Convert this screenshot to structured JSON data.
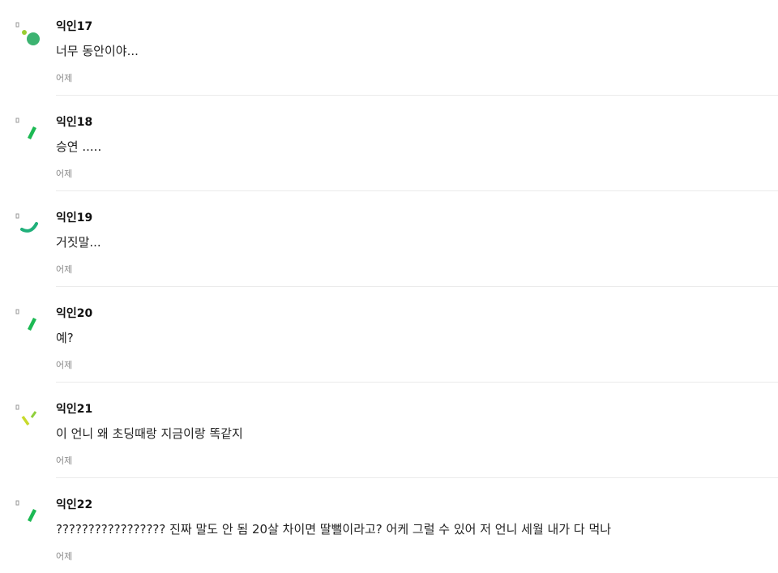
{
  "comments": [
    {
      "nickname": "익인17",
      "text": "너무 동안이야...",
      "time": "어제",
      "avatar_icon": "green-dots-avatar-icon",
      "avatar_color": "#3cb371",
      "avatar_accent": "#9acd32"
    },
    {
      "nickname": "익인18",
      "text": "승연 .....",
      "time": "어제",
      "avatar_icon": "green-slash-avatar-icon",
      "avatar_color": "#1db954"
    },
    {
      "nickname": "익인19",
      "text": "거짓말...",
      "time": "어제",
      "avatar_icon": "green-curve-avatar-icon",
      "avatar_color": "#20b07a"
    },
    {
      "nickname": "익인20",
      "text": "예?",
      "time": "어제",
      "avatar_icon": "green-slash-avatar-icon",
      "avatar_color": "#1db954"
    },
    {
      "nickname": "익인21",
      "text": "이 언니 왜 초딩때랑 지금이랑 똑같지",
      "time": "어제",
      "avatar_icon": "lime-strokes-avatar-icon",
      "avatar_color": "#b8d630",
      "avatar_accent": "#1db954"
    },
    {
      "nickname": "익인22",
      "text": "????????????????? 진짜 말도 안 됨 20살 차이면 딸뻘이라고? 어케 그럴 수 있어 저 언니 세월 내가 다 먹나",
      "time": "어제",
      "avatar_icon": "green-slash-avatar-icon",
      "avatar_color": "#1db954"
    }
  ]
}
